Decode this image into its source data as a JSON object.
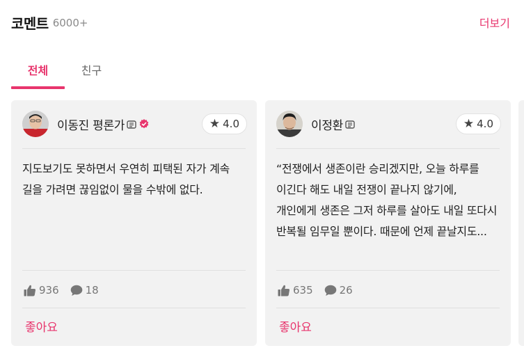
{
  "header": {
    "title": "코멘트",
    "count": "6000+",
    "more_label": "더보기"
  },
  "tabs": [
    {
      "label": "전체",
      "active": true
    },
    {
      "label": "친구",
      "active": false
    }
  ],
  "accent_color": "#e8356d",
  "comments": [
    {
      "author": "이동진 평론가",
      "verified": true,
      "rating": "4.0",
      "text": "지도보기도 못하면서 우연히 피택된 자가 계속 길을 가려면 끊임없이 물을 수밖에 없다.",
      "likes": "936",
      "replies": "18",
      "like_label": "좋아요"
    },
    {
      "author": "이정환",
      "verified": false,
      "rating": "4.0",
      "text": "“전쟁에서 생존이란 승리겠지만, 오늘 하루를 이긴다 해도 내일 전쟁이 끝나지 않기에, 개인에게 생존은 그저 하루를 살아도 내일 또다시 반복될 임무일 뿐이다. 때문에 언제 끝날지도...",
      "likes": "635",
      "replies": "26",
      "like_label": "좋아요"
    }
  ],
  "icons": {
    "rating": "star-icon",
    "likes": "thumbs-up-icon",
    "replies": "speech-bubble-icon",
    "badge": "watcha-badge-icon",
    "verified": "verified-check-icon"
  }
}
